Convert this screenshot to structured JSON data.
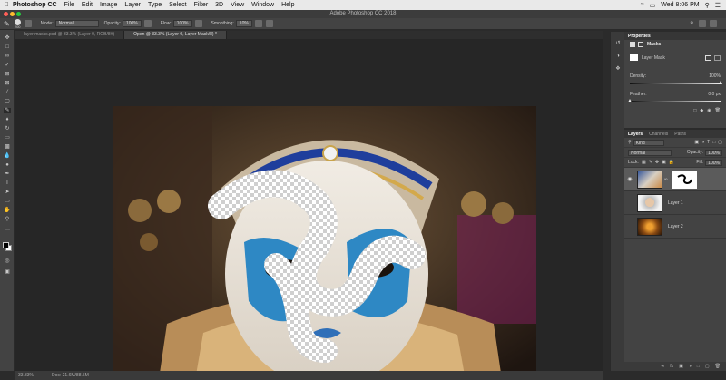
{
  "menubar": {
    "app_name": "Photoshop CC",
    "items": [
      "File",
      "Edit",
      "Image",
      "Layer",
      "Type",
      "Select",
      "Filter",
      "3D",
      "View",
      "Window",
      "Help"
    ],
    "clock": "Wed 8:06 PM"
  },
  "window": {
    "title": "Adobe Photoshop CC 2018"
  },
  "options": {
    "brush_size": "200",
    "mode_label": "Mode:",
    "mode_value": "Normal",
    "opacity_label": "Opacity:",
    "opacity_value": "100%",
    "flow_label": "Flow:",
    "flow_value": "100%",
    "smoothing_label": "Smoothing:",
    "smoothing_value": "10%"
  },
  "doc_tabs": [
    {
      "label": "layer masks.psd @ 33.3% (Layer 0, RGB/8#)",
      "active": false
    },
    {
      "label": "Open @ 33.3% (Layer 0, Layer Mask/8) *",
      "active": true
    }
  ],
  "status": {
    "zoom": "33.33%",
    "doc": "Doc: 21.6M/88.5M"
  },
  "properties": {
    "tab_label": "Properties",
    "section_label": "Masks",
    "mask_type": "Layer Mask",
    "density_label": "Density:",
    "density_value": "100%",
    "density_fraction": 1.0,
    "feather_label": "Feather:",
    "feather_value": "0.0 px",
    "feather_fraction": 0.0
  },
  "layers_panel": {
    "tabs": [
      "Layers",
      "Channels",
      "Paths"
    ],
    "kind_label": "Kind",
    "blend_mode": "Normal",
    "opacity_label": "Opacity:",
    "opacity_value": "100%",
    "lock_label": "Lock:",
    "fill_label": "Fill:",
    "fill_value": "100%",
    "layers": [
      {
        "name": "",
        "has_mask": true,
        "visible": true,
        "selected": true
      },
      {
        "name": "Layer 1",
        "has_mask": false,
        "visible": false,
        "selected": false
      },
      {
        "name": "Layer 2",
        "has_mask": false,
        "visible": false,
        "selected": false
      }
    ]
  },
  "colors": {
    "menubar_bg": "#e9e9e9",
    "app_bg": "#434343",
    "canvas_bg": "#262626",
    "selected_layer": "#5b5b5b"
  }
}
